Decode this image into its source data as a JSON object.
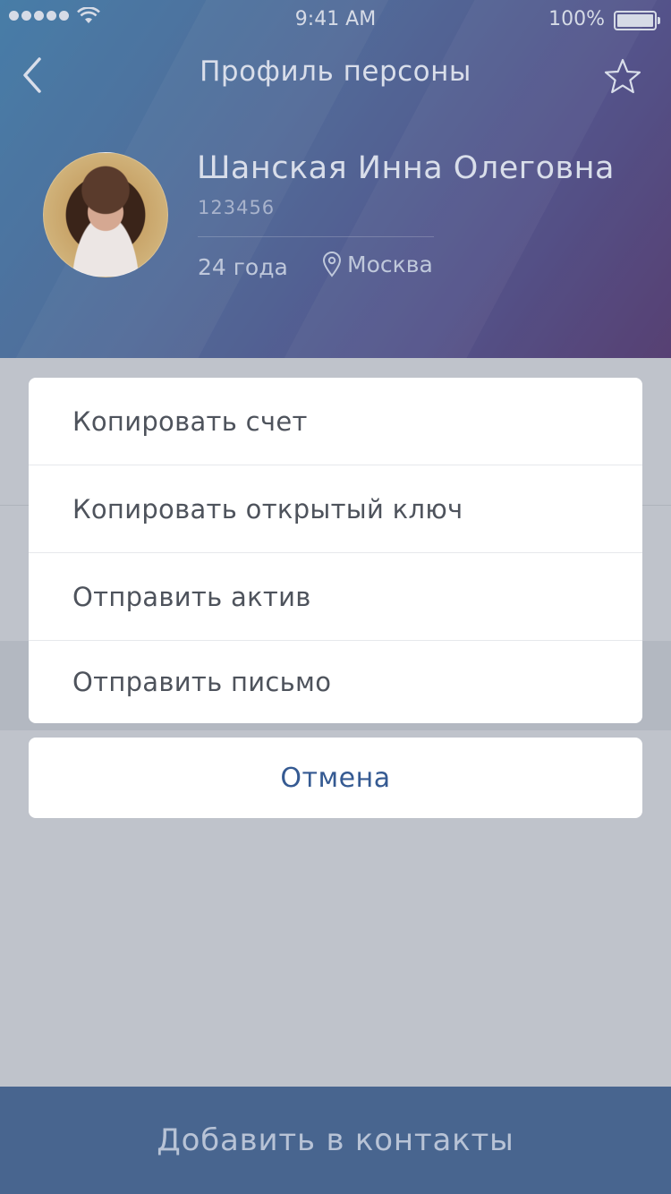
{
  "status_bar": {
    "time": "9:41 AM",
    "battery_percent": "100%",
    "battery_level": 1.0,
    "signal_bars": 5
  },
  "nav": {
    "title": "Профиль персоны",
    "back_icon": "chevron-left-icon",
    "favorite_icon": "star-outline-icon"
  },
  "profile": {
    "name": "Шанская Инна Олеговна",
    "id": "123456",
    "age": "24 года",
    "city": "Москва",
    "location_icon": "map-pin-icon"
  },
  "action_sheet": {
    "items": [
      {
        "label": "Копировать счет"
      },
      {
        "label": "Копировать открытый ключ"
      },
      {
        "label": "Отправить актив"
      },
      {
        "label": "Отправить письмо"
      }
    ],
    "cancel_label": "Отмена"
  },
  "footer": {
    "cta_label": "Добавить в контакты"
  },
  "colors": {
    "accent": "#355a92",
    "cta_bg": "#48658f",
    "overlay_bg": "#bfc3cb"
  }
}
